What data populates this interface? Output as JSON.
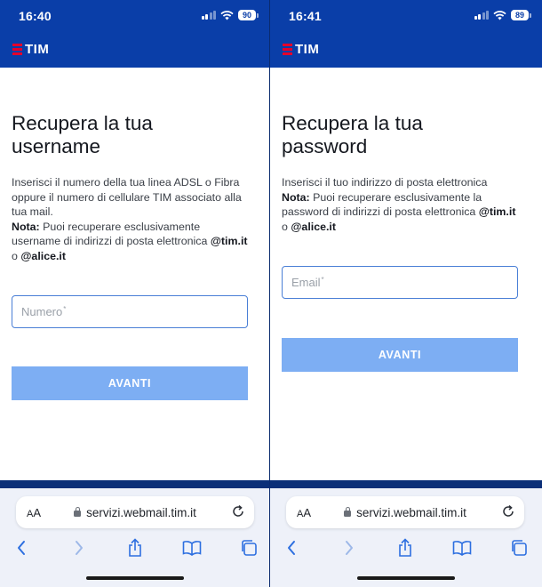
{
  "colors": {
    "brand_blue": "#0a3ea8",
    "accent_red": "#e4002b",
    "button": "#7daef3",
    "input_border": "#4a7fd6"
  },
  "left": {
    "status_time": "16:40",
    "battery": "90",
    "brand": "TIM",
    "title_line1": "Recupera la tua",
    "title_line2": "username",
    "desc_text": "Inserisci il numero della tua linea ADSL o Fibra oppure il numero di cellulare TIM associato alla tua mail.",
    "note_label": "Nota:",
    "note_text": " Puoi recuperare esclusivamente username di indirizzi di posta elettronica ",
    "domain1": "@tim.it",
    "or_text": " o ",
    "domain2": "@alice.it",
    "input_placeholder": "Numero",
    "required_mark": "*",
    "button": "AVANTI",
    "url_aa_small": "A",
    "url_aa_big": "A",
    "url": "servizi.webmail.tim.it"
  },
  "right": {
    "status_time": "16:41",
    "battery": "89",
    "brand": "TIM",
    "title_line1": "Recupera la tua",
    "title_line2": "password",
    "desc_text": "Inserisci il tuo indirizzo di posta elettronica",
    "note_label": "Nota:",
    "note_text": " Puoi recuperare esclusivamente la password di indirizzi di posta elettronica ",
    "domain1": "@tim.it",
    "or_text": " o ",
    "domain2": "@alice.it",
    "input_placeholder": "Email",
    "required_mark": "*",
    "button": "AVANTI",
    "url_aa_small": "A",
    "url_aa_big": "A",
    "url": "servizi.webmail.tim.it"
  },
  "icons": [
    "signal-icon",
    "wifi-icon",
    "battery-icon",
    "lock-icon",
    "reload-icon",
    "back-icon",
    "forward-icon",
    "share-icon",
    "bookmarks-icon",
    "tabs-icon"
  ]
}
